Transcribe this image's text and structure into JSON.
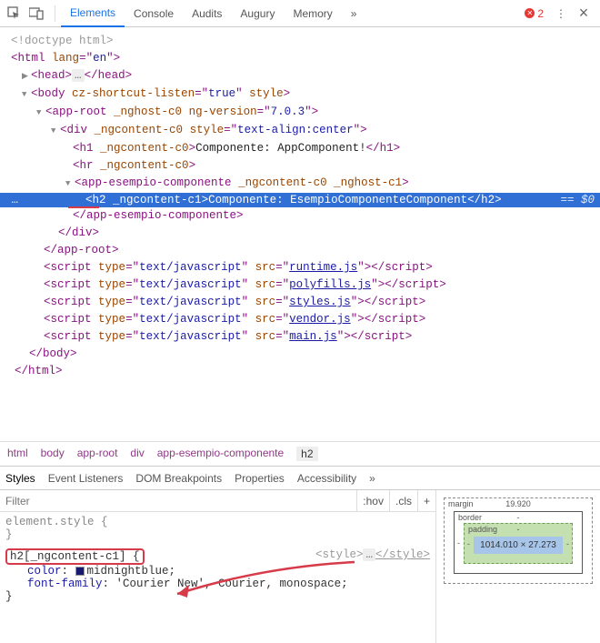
{
  "toolbar": {
    "tabs": [
      "Elements",
      "Console",
      "Audits",
      "Augury",
      "Memory"
    ],
    "active_tab": "Elements",
    "overflow": "»",
    "error_count": "2",
    "menu": "⋮",
    "close": "×"
  },
  "dom": {
    "doctype": "<!doctype html>",
    "html_open": {
      "tag": "html",
      "attrs": [
        {
          "n": "lang",
          "v": "en"
        }
      ]
    },
    "head": {
      "tag": "head",
      "collapsed": "…"
    },
    "body": {
      "tag": "body",
      "attrs": [
        {
          "n": "cz-shortcut-listen",
          "v": "true"
        },
        {
          "n": "style",
          "v": ""
        }
      ]
    },
    "app_root": {
      "tag": "app-root",
      "attrs": [
        {
          "n": "_nghost-c0",
          "v": ""
        },
        {
          "n": "ng-version",
          "v": "7.0.3"
        }
      ]
    },
    "div": {
      "tag": "div",
      "attrs": [
        {
          "n": "_ngcontent-c0",
          "v": ""
        },
        {
          "n": "style",
          "v": "text-align:center"
        }
      ]
    },
    "h1": {
      "tag": "h1",
      "attrs": [
        {
          "n": "_ngcontent-c0",
          "v": ""
        }
      ],
      "text": "Componente: AppComponent!"
    },
    "hr": {
      "tag": "hr",
      "attrs": [
        {
          "n": "_ngcontent-c0",
          "v": ""
        }
      ]
    },
    "esempio": {
      "tag": "app-esempio-componente",
      "attrs": [
        {
          "n": "_ngcontent-c0",
          "v": ""
        },
        {
          "n": "_nghost-c1",
          "v": ""
        }
      ]
    },
    "h2": {
      "tag": "h2",
      "attrs": [
        {
          "n": "_ngcontent-c1",
          "v": ""
        }
      ],
      "text": "Componente: EsempioComponenteComponent"
    },
    "selected_suffix": "== $0",
    "close_esempio": "app-esempio-componente",
    "close_div": "div",
    "close_approot": "app-root",
    "scripts": [
      {
        "src": "runtime.js"
      },
      {
        "src": "polyfills.js"
      },
      {
        "src": "styles.js"
      },
      {
        "src": "vendor.js"
      },
      {
        "src": "main.js"
      }
    ],
    "script_type": "text/javascript",
    "close_body": "body",
    "close_html": "html",
    "gutter_ellipsis": "…"
  },
  "breadcrumb": [
    "html",
    "body",
    "app-root",
    "div",
    "app-esempio-componente",
    "h2"
  ],
  "subtabs": {
    "items": [
      "Styles",
      "Event Listeners",
      "DOM Breakpoints",
      "Properties",
      "Accessibility"
    ],
    "active": "Styles",
    "overflow": "»"
  },
  "styles_panel": {
    "filter_placeholder": "Filter",
    "hov": ":hov",
    "cls": ".cls",
    "plus": "+",
    "element_style": "element.style {",
    "brace_close": "}",
    "selector": "h2[_ngcontent-c1] {",
    "rule_source_prefix": "<style>",
    "rule_source_mid": "…",
    "rule_source_suffix": "</style>",
    "prop_color_name": "color",
    "prop_color_value": "midnightblue",
    "prop_font_name": "font-family",
    "prop_font_value": "'Courier New', Courier, monospace",
    "semicolon": ";"
  },
  "box_model": {
    "margin_label": "margin",
    "margin_top": "19.920",
    "border_label": "border",
    "border_val": "-",
    "padding_label": "padding",
    "padding_val": "-",
    "content": "1014.010 × 27.273",
    "side_dash": "-"
  }
}
